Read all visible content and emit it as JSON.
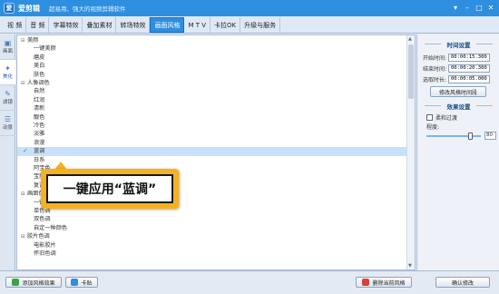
{
  "app": {
    "name": "爱剪辑",
    "logo_text": "爱",
    "slogan": "超易用、强大的视频剪辑软件"
  },
  "window_buttons": [
    "▾",
    "–",
    "□",
    "✕"
  ],
  "tabs": [
    "视 频",
    "音 频",
    "字幕特效",
    "叠加素材",
    "转场特效",
    "画面风格",
    "M T V",
    "卡拉OK",
    "升级与服务"
  ],
  "active_tab": 5,
  "leftnav": [
    {
      "label": "画面",
      "icon": "▣"
    },
    {
      "label": "美化",
      "icon": "✦"
    },
    {
      "label": "滤镜",
      "icon": "✎"
    },
    {
      "label": "动景",
      "icon": "☰"
    }
  ],
  "list_rows": [
    {
      "t": "美颜",
      "cat": true
    },
    {
      "t": "一键美颜"
    },
    {
      "t": "磨皮"
    },
    {
      "t": "美白"
    },
    {
      "t": "肤色"
    },
    {
      "t": "人像调色",
      "cat": true
    },
    {
      "t": "自然"
    },
    {
      "t": "红润"
    },
    {
      "t": "清新"
    },
    {
      "t": "靓色"
    },
    {
      "t": "冷色"
    },
    {
      "t": "淡雅"
    },
    {
      "t": "浪漫"
    },
    {
      "t": "蓝调",
      "sel": true
    },
    {
      "t": "日系"
    },
    {
      "t": "阿宝色"
    },
    {
      "t": "宝丽来"
    },
    {
      "t": "复古"
    },
    {
      "t": "画面色调",
      "cat": true
    },
    {
      "t": "一键画面色彩调色"
    },
    {
      "t": "单色调"
    },
    {
      "t": "双色调"
    },
    {
      "t": "自定一种颜色"
    },
    {
      "t": "胶片色调",
      "cat": true
    },
    {
      "t": "电影胶片"
    },
    {
      "t": "怀旧色调"
    }
  ],
  "callout": {
    "text": "一键应用“蓝调”"
  },
  "time_settings": {
    "title": "时间设置",
    "start_label": "开始时间:",
    "start_value": "00:00:15.300",
    "end_label": "结束时间:",
    "end_value": "00:00:20.300",
    "duration_label": "选取时长:",
    "duration_value": "00:00:05.000",
    "modify_button": "修改风格时间段"
  },
  "effect_settings": {
    "title": "效果设置",
    "fade_label": "柔和过渡",
    "degree_label": "程度:",
    "degree_value": "80",
    "degree_level": 0.8
  },
  "bottom": {
    "add_button": "添加风格效果",
    "tip_button": "卡贴",
    "delete_button": "删除当前风格",
    "confirm_button": "确认修改"
  }
}
